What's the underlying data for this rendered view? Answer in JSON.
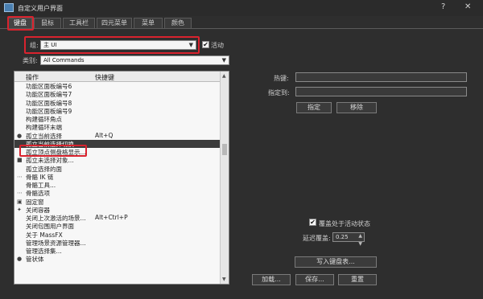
{
  "window": {
    "title": "自定义用户界面",
    "help": "?",
    "close": "✕"
  },
  "tabs": [
    {
      "label": "键盘",
      "active": true
    },
    {
      "label": "鼠标"
    },
    {
      "label": "工具栏"
    },
    {
      "label": "四元菜单"
    },
    {
      "label": "菜单"
    },
    {
      "label": "颜色"
    }
  ],
  "group": {
    "label": "组:",
    "value": "主 UI",
    "active_label": "活动",
    "active_checked": true
  },
  "category": {
    "label": "类别:",
    "value": "All Commands"
  },
  "list": {
    "col_action": "操作",
    "col_shortcut": "快捷键",
    "rows": [
      {
        "icon": "",
        "action": "功能区面板编号6",
        "key": ""
      },
      {
        "icon": "",
        "action": "功能区面板编号7",
        "key": ""
      },
      {
        "icon": "",
        "action": "功能区面板编号8",
        "key": ""
      },
      {
        "icon": "",
        "action": "功能区面板编号9",
        "key": ""
      },
      {
        "icon": "",
        "action": "构建循环角点",
        "key": ""
      },
      {
        "icon": "",
        "action": "构建循环末端",
        "key": ""
      },
      {
        "icon": "●",
        "action": "孤立当前选择",
        "key": "Alt+Q"
      },
      {
        "icon": "",
        "action": "孤立当前选择切换",
        "key": "",
        "selected": true
      },
      {
        "icon": "",
        "action": "孤立顶点侧盘格显示...",
        "key": ""
      },
      {
        "icon": "■",
        "action": "孤立未选择对象...",
        "key": ""
      },
      {
        "icon": "",
        "action": "孤立选择的面",
        "key": ""
      },
      {
        "icon": "⋯",
        "action": "骨骼 IK 链",
        "key": ""
      },
      {
        "icon": "",
        "action": "骨骼工具...",
        "key": ""
      },
      {
        "icon": "⋯",
        "action": "骨骼选项",
        "key": ""
      },
      {
        "icon": "▣",
        "action": "固定窗",
        "key": ""
      },
      {
        "icon": "✦",
        "action": "关闭容器",
        "key": ""
      },
      {
        "icon": "",
        "action": "关闭上次激活的场景...",
        "key": "Alt+Ctrl+P"
      },
      {
        "icon": "",
        "action": "关闭包围用户界面",
        "key": ""
      },
      {
        "icon": "",
        "action": "关于 MassFX",
        "key": ""
      },
      {
        "icon": "",
        "action": "管理场景资源管理器...",
        "key": ""
      },
      {
        "icon": "",
        "action": "管理选择集...",
        "key": ""
      },
      {
        "icon": "●",
        "action": "管状体",
        "key": ""
      }
    ]
  },
  "hotkey": {
    "label": "热键:",
    "value": ""
  },
  "assigned_to": {
    "label": "指定到:",
    "value": ""
  },
  "assign_button": "指定",
  "remove_button": "移除",
  "override": {
    "label": "覆盖处于活动状态",
    "checked": true
  },
  "delay_override": {
    "label": "延迟覆盖:",
    "value": "0.25"
  },
  "write_keyboard_button": "写入键盘表...",
  "load_button": "加载...",
  "save_button": "保存...",
  "reset_button": "重置"
}
